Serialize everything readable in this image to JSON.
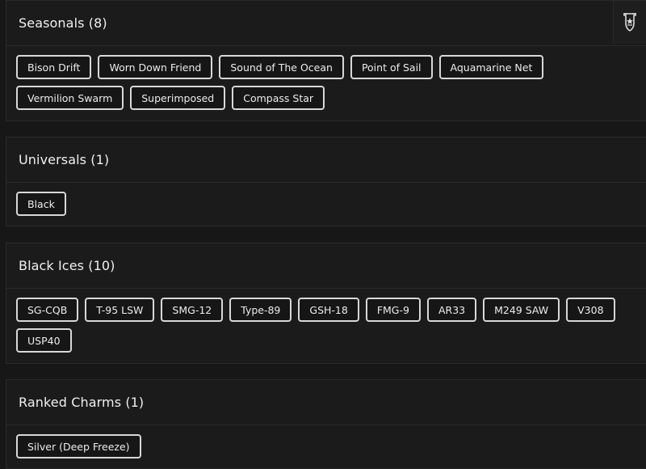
{
  "sections": [
    {
      "title": "Seasonals (8)",
      "tags": [
        "Bison Drift",
        "Worn Down Friend",
        "Sound of The Ocean",
        "Point of Sail",
        "Aquamarine Net",
        "Vermilion Swarm",
        "Superimposed",
        "Compass Star"
      ]
    },
    {
      "title": "Universals (1)",
      "tags": [
        "Black"
      ]
    },
    {
      "title": "Black Ices (10)",
      "tags": [
        "SG-CQB",
        "T-95 LSW",
        "SMG-12",
        "Type-89",
        "GSH-18",
        "FMG-9",
        "AR33",
        "M249 SAW",
        "V308",
        "USP40"
      ]
    },
    {
      "title": "Ranked Charms (1)",
      "tags": [
        "Silver (Deep Freeze)"
      ]
    }
  ],
  "corner_icon": "shield-badge-icon"
}
